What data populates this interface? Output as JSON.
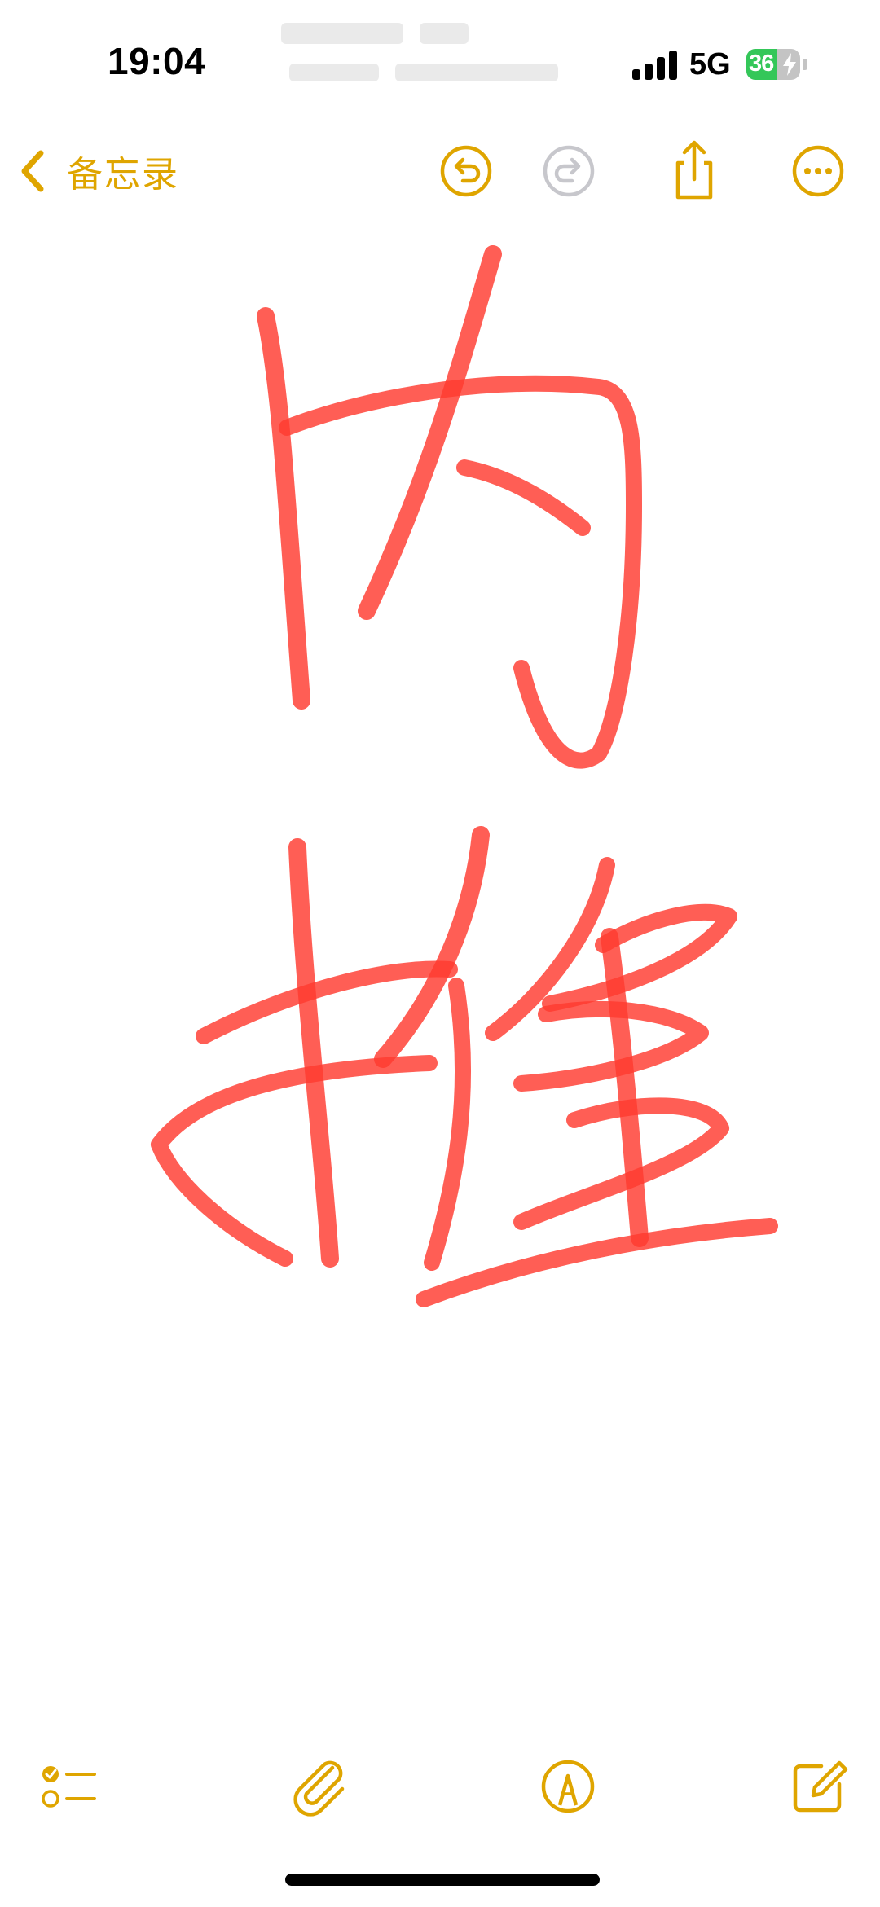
{
  "status_bar": {
    "time": "19:04",
    "network": "5G",
    "battery_level": "36",
    "battery_fraction": 0.36,
    "charging": true
  },
  "nav": {
    "back_label": "备忘录",
    "icons": [
      "undo-icon",
      "redo-icon",
      "share-icon",
      "more-icon"
    ],
    "redo_enabled": false
  },
  "note": {
    "content_type": "handwriting-drawing",
    "ink_color": "#ff3b30"
  },
  "toolbar": {
    "icons": [
      "checklist-icon",
      "attachment-icon",
      "markup-icon",
      "compose-icon"
    ]
  },
  "colors": {
    "accent": "#dfa500",
    "disabled": "#c7c7cc",
    "background": "#ffffff"
  }
}
